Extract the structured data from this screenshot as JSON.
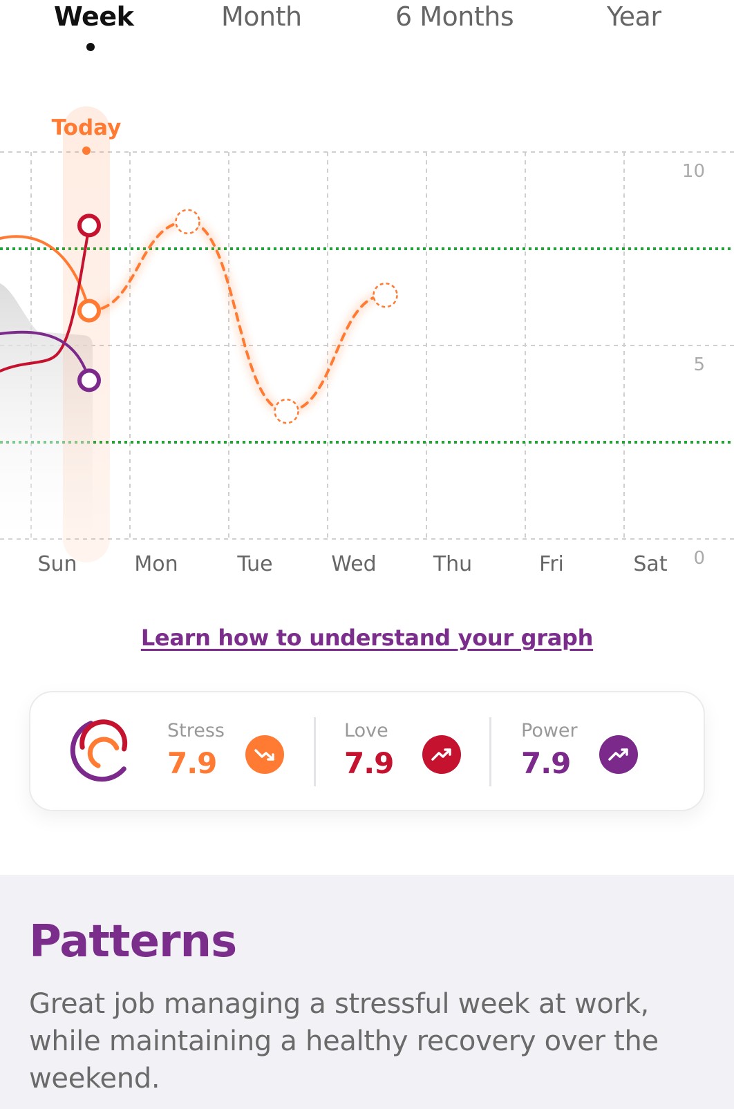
{
  "tabs": [
    {
      "label": "Week",
      "active": true
    },
    {
      "label": "Month",
      "active": false
    },
    {
      "label": "6 Months",
      "active": false
    },
    {
      "label": "Year",
      "active": false
    }
  ],
  "chart_data": {
    "type": "line",
    "categories": [
      "Sun",
      "Mon",
      "Tue",
      "Wed",
      "Thu",
      "Fri",
      "Sat"
    ],
    "ylim": [
      0,
      10
    ],
    "yticks": [
      "10",
      "5",
      "0"
    ],
    "today_label": "Today",
    "target_range": [
      2.5,
      7.5
    ],
    "series": [
      {
        "key": "stress_forecast",
        "color": "#ff7a33",
        "points": [
          [
            0.3,
            5.9
          ],
          [
            1.5,
            8.2
          ],
          [
            2.5,
            3.3
          ],
          [
            3.5,
            6.3
          ]
        ]
      }
    ],
    "history": {
      "stress": {
        "color": "#ff7a33",
        "today_value": 5.9
      },
      "love": {
        "color": "#c4122f",
        "today_value": 8.1
      },
      "power": {
        "color": "#7b2a8b",
        "today_value": 4.1
      }
    }
  },
  "link": {
    "learn_label": "Learn how to understand your graph"
  },
  "summary": {
    "metrics": [
      {
        "label": "Stress",
        "value": "7.9",
        "color": "#ff7a33",
        "trend": "down",
        "icon": "trend-down-icon"
      },
      {
        "label": "Love",
        "value": "7.9",
        "color": "#c4122f",
        "trend": "up",
        "icon": "trend-up-icon"
      },
      {
        "label": "Power",
        "value": "7.9",
        "color": "#7b2a8b",
        "trend": "up",
        "icon": "trend-up-icon"
      }
    ]
  },
  "patterns": {
    "title": "Patterns",
    "text": "Great job managing a stressful week at work, while maintaining a healthy recovery over the weekend."
  }
}
